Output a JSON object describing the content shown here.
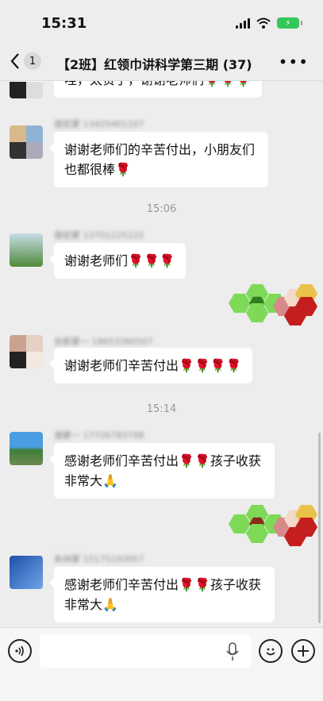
{
  "status": {
    "time": "15:31",
    "battery_symbol": "⚡"
  },
  "nav": {
    "back_count": "1",
    "title": "【2班】红领巾讲科学第三期 (37)",
    "more": "•••"
  },
  "messages": [
    {
      "sender": "",
      "text": "哇，太赞了，谢谢老师们",
      "flowers": "🌹🌹🌹"
    },
    {
      "sender": "骆驼蒙 13425401107",
      "text": "谢谢老师们的辛苦付出，小朋友们也都很棒",
      "flowers": "🌹"
    },
    {
      "sender": "骆驼蒙 13701225222",
      "text": "谢谢老师们",
      "flowers": "🌹🌹🌹"
    },
    {
      "sender": "张斯蒙一 18653380507",
      "text": "谢谢老师们辛苦付出",
      "flowers": "🌹🌹🌹🌹"
    },
    {
      "sender": "潮蒙一 17726783798",
      "text": "感谢老师们辛苦付出",
      "flowers": "🌹🌹",
      "tail": "孩子收获非常大",
      "emoji": "🙏"
    },
    {
      "sender": "朱林蒙 15175193057",
      "text": "感谢老师们辛苦付出",
      "flowers": "🌹🌹",
      "tail": "孩子收获非常大",
      "emoji": "🙏"
    }
  ],
  "timestamps": [
    "15:06",
    "15:14"
  ],
  "colors": {
    "background": "#ededed",
    "bubble": "#ffffff",
    "accent_green": "#34c759"
  }
}
